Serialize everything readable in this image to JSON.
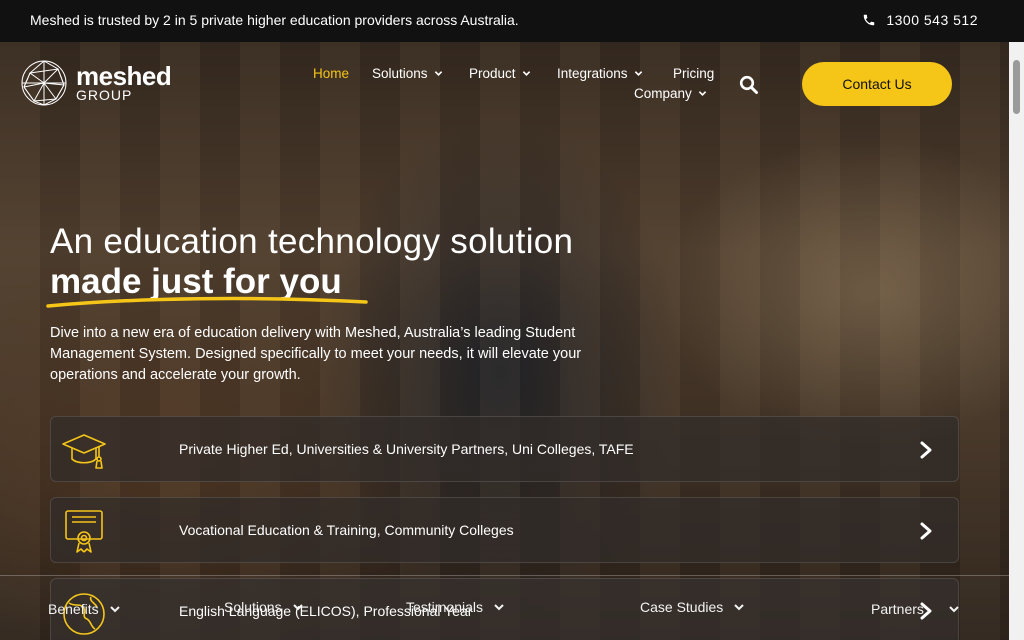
{
  "topbar": {
    "trust_text": "Meshed is trusted by 2 in 5 private higher education providers across Australia.",
    "phone": "1300 543 512"
  },
  "logo": {
    "brand": "meshed",
    "group": "GROUP"
  },
  "nav": {
    "home": "Home",
    "solutions": "Solutions",
    "product": "Product",
    "integrations": "Integrations",
    "pricing": "Pricing",
    "company": "Company",
    "contact": "Contact Us"
  },
  "hero": {
    "heading_line1": "An education technology solution",
    "heading_line2": "made just for you",
    "lead": "Dive into a new era of education delivery with Meshed, Australia’s leading Student Management System. Designed specifically to meet your needs, it will elevate your operations and accelerate your growth."
  },
  "cards": [
    {
      "label": "Private Higher Ed, Universities & University Partners, Uni Colleges, TAFE",
      "icon": "graduation-cap-icon"
    },
    {
      "label": "Vocational Education & Training, Community Colleges",
      "icon": "certificate-icon"
    },
    {
      "label": "English Language (ELICOS), Professional Year",
      "icon": "globe-icon"
    }
  ],
  "subnav": {
    "benefits": "Benefits",
    "solutions": "Solutions",
    "testimonials": "Testimonials",
    "case_studies": "Case Studies",
    "partners": "Partners"
  },
  "colors": {
    "accent": "#f5c518",
    "topbar": "#111111"
  }
}
